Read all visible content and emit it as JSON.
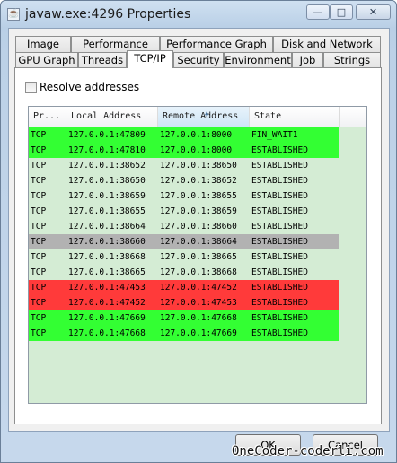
{
  "window": {
    "title": "javaw.exe:4296 Properties",
    "min_glyph": "—",
    "max_glyph": "□",
    "close_glyph": "✕"
  },
  "tabs": {
    "row_back": [
      "Image",
      "Performance",
      "Performance Graph",
      "Disk and Network"
    ],
    "row_front": [
      "GPU Graph",
      "Threads",
      "TCP/IP",
      "Security",
      "Environment",
      "Job",
      "Strings"
    ],
    "active": "TCP/IP"
  },
  "options": {
    "resolve_addresses_label": "Resolve addresses",
    "resolve_addresses_checked": false
  },
  "table": {
    "columns": [
      "Pr...",
      "Local Address",
      "Remote Address",
      "State"
    ],
    "sorted_column": "Remote Address",
    "rows": [
      {
        "proto": "TCP",
        "local": "127.0.0.1:47809",
        "remote": "127.0.0.1:8000",
        "state": "FIN_WAIT1",
        "status": "new"
      },
      {
        "proto": "TCP",
        "local": "127.0.0.1:47810",
        "remote": "127.0.0.1:8000",
        "state": "ESTABLISHED",
        "status": "new"
      },
      {
        "proto": "TCP",
        "local": "127.0.0.1:38652",
        "remote": "127.0.0.1:38650",
        "state": "ESTABLISHED",
        "status": "normal"
      },
      {
        "proto": "TCP",
        "local": "127.0.0.1:38650",
        "remote": "127.0.0.1:38652",
        "state": "ESTABLISHED",
        "status": "normal"
      },
      {
        "proto": "TCP",
        "local": "127.0.0.1:38659",
        "remote": "127.0.0.1:38655",
        "state": "ESTABLISHED",
        "status": "normal"
      },
      {
        "proto": "TCP",
        "local": "127.0.0.1:38655",
        "remote": "127.0.0.1:38659",
        "state": "ESTABLISHED",
        "status": "normal"
      },
      {
        "proto": "TCP",
        "local": "127.0.0.1:38664",
        "remote": "127.0.0.1:38660",
        "state": "ESTABLISHED",
        "status": "normal"
      },
      {
        "proto": "TCP",
        "local": "127.0.0.1:38660",
        "remote": "127.0.0.1:38664",
        "state": "ESTABLISHED",
        "status": "selected"
      },
      {
        "proto": "TCP",
        "local": "127.0.0.1:38668",
        "remote": "127.0.0.1:38665",
        "state": "ESTABLISHED",
        "status": "normal"
      },
      {
        "proto": "TCP",
        "local": "127.0.0.1:38665",
        "remote": "127.0.0.1:38668",
        "state": "ESTABLISHED",
        "status": "normal"
      },
      {
        "proto": "TCP",
        "local": "127.0.0.1:47453",
        "remote": "127.0.0.1:47452",
        "state": "ESTABLISHED",
        "status": "closing"
      },
      {
        "proto": "TCP",
        "local": "127.0.0.1:47452",
        "remote": "127.0.0.1:47453",
        "state": "ESTABLISHED",
        "status": "closing"
      },
      {
        "proto": "TCP",
        "local": "127.0.0.1:47669",
        "remote": "127.0.0.1:47668",
        "state": "ESTABLISHED",
        "status": "new"
      },
      {
        "proto": "TCP",
        "local": "127.0.0.1:47668",
        "remote": "127.0.0.1:47669",
        "state": "ESTABLISHED",
        "status": "new"
      }
    ]
  },
  "colors": {
    "new": "#33ff33",
    "closing": "#ff3a3a",
    "selected": "#b2b2b2",
    "table_background": "#d4ecd4"
  },
  "buttons": {
    "ok": "OK",
    "cancel": "Cancel"
  },
  "watermark": "OneCoder-coderli.com"
}
